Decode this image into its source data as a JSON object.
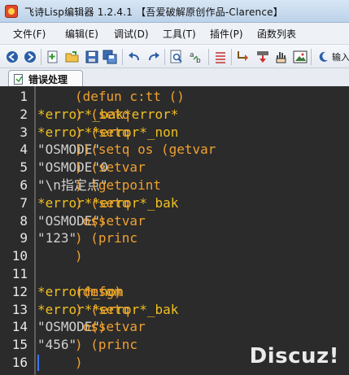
{
  "window": {
    "title": "飞诗Lisp编辑器 1.2.4.1  【吾爱破解原创作品-Clarence】"
  },
  "menu": {
    "items": [
      "文件(F)",
      "编辑(E)",
      "调试(D)",
      "工具(T)",
      "插件(P)",
      "函数列表"
    ]
  },
  "toolbar": {
    "input_label": "输入"
  },
  "tabs": [
    {
      "label": "错误处理"
    }
  ],
  "editor": {
    "line_numbers": [
      "1",
      "2",
      "3",
      "4",
      "5",
      "6",
      "7",
      "8",
      "9",
      "10",
      "11",
      "12",
      "13",
      "14",
      "15",
      "16"
    ],
    "lines": [
      [
        {
          "t": "(defun c:tt ()",
          "c": "code"
        }
      ],
      [
        {
          "t": "  (setq ",
          "c": "code"
        },
        {
          "t": "*error*_bak",
          "c": "var"
        },
        {
          "t": " ",
          "c": "code"
        },
        {
          "t": "*error*",
          "c": "var"
        },
        {
          "t": ")",
          "c": "code"
        }
      ],
      [
        {
          "t": "  (setq ",
          "c": "code"
        },
        {
          "t": "*error*",
          "c": "var"
        },
        {
          "t": " ",
          "c": "code"
        },
        {
          "t": "*error*_non",
          "c": "var"
        },
        {
          "t": ")",
          "c": "code"
        }
      ],
      [
        {
          "t": "  (setq os (getvar ",
          "c": "code"
        },
        {
          "t": "\"OSMODE\"",
          "c": "str"
        },
        {
          "t": "))",
          "c": "code"
        }
      ],
      [
        {
          "t": "  (setvar ",
          "c": "code"
        },
        {
          "t": "\"OSMODE\"",
          "c": "str"
        },
        {
          "t": " ",
          "c": "code"
        },
        {
          "t": "0",
          "c": "num"
        },
        {
          "t": ")",
          "c": "code"
        }
      ],
      [
        {
          "t": "  (getpoint ",
          "c": "code"
        },
        {
          "t": "\"\\n指定点\"",
          "c": "str"
        },
        {
          "t": ")",
          "c": "code"
        }
      ],
      [
        {
          "t": "  (setq ",
          "c": "code"
        },
        {
          "t": "*error*",
          "c": "var"
        },
        {
          "t": " ",
          "c": "code"
        },
        {
          "t": "*error*_bak",
          "c": "var"
        },
        {
          "t": ")",
          "c": "code"
        }
      ],
      [
        {
          "t": "  (setvar ",
          "c": "code"
        },
        {
          "t": "\"OSMODE\"",
          "c": "str"
        },
        {
          "t": " os)",
          "c": "code"
        }
      ],
      [
        {
          "t": "  (princ ",
          "c": "code"
        },
        {
          "t": "\"123\"",
          "c": "str"
        },
        {
          "t": ")",
          "c": "code"
        }
      ],
      [
        {
          "t": ")",
          "c": "code"
        }
      ],
      [
        {
          "t": "",
          "c": "code"
        }
      ],
      [
        {
          "t": "(defun ",
          "c": "code"
        },
        {
          "t": "*error*_non",
          "c": "var"
        },
        {
          "t": " (msg)",
          "c": "code"
        }
      ],
      [
        {
          "t": "  (setq ",
          "c": "code"
        },
        {
          "t": "*error*",
          "c": "var"
        },
        {
          "t": " ",
          "c": "code"
        },
        {
          "t": "*error*_bak",
          "c": "var"
        },
        {
          "t": ")",
          "c": "code"
        }
      ],
      [
        {
          "t": "  (setvar ",
          "c": "code"
        },
        {
          "t": "\"OSMODE\"",
          "c": "str"
        },
        {
          "t": " os)",
          "c": "code"
        }
      ],
      [
        {
          "t": "  (princ ",
          "c": "code"
        },
        {
          "t": "\"456\"",
          "c": "str"
        },
        {
          "t": ")",
          "c": "code"
        }
      ],
      [
        {
          "t": ")",
          "c": "code"
        }
      ]
    ]
  },
  "watermark": "Discuz!",
  "colors": {
    "editor_bg": "#2b2b2b",
    "paren": "#f0a030",
    "symbol": "#f0c020",
    "string": "#d0d0d0"
  }
}
